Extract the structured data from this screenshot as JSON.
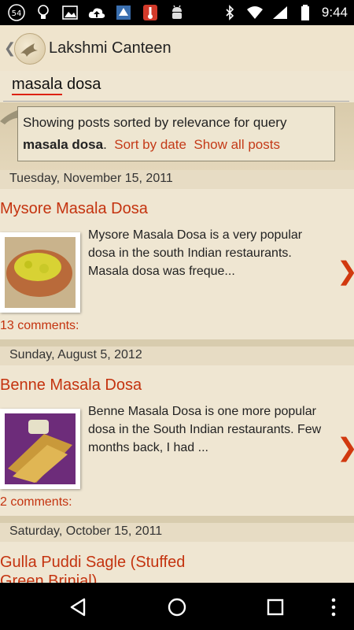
{
  "status": {
    "notification_badge": "54",
    "time": "9:44"
  },
  "header": {
    "title": "Lakshmi Canteen"
  },
  "search": {
    "query": "masala dosa"
  },
  "banner": {
    "prefix": "Showing posts sorted by relevance for query",
    "query": "masala dosa",
    "sort_by_date": "Sort by date",
    "show_all": "Show all posts"
  },
  "posts": [
    {
      "date": "Tuesday, November 15, 2011",
      "title": "Mysore Masala Dosa",
      "excerpt": "Mysore Masala Dosa is a very popular dosa in the south Indian restaurants. Masala dosa  was freque...",
      "comments": "13 comments:"
    },
    {
      "date": "Sunday, August 5, 2012",
      "title": "Benne Masala Dosa",
      "excerpt": "Benne Masala Dosa is one more popular dosa in the South Indian restaurants. Few months back, I had ...",
      "comments": "2 comments:"
    },
    {
      "date": "Saturday, October 15, 2011",
      "title": "Gulla Puddi Sagle (Stuffed Green Brinjal)"
    }
  ],
  "colors": {
    "accent": "#c4330f",
    "background": "#efe6d2"
  }
}
